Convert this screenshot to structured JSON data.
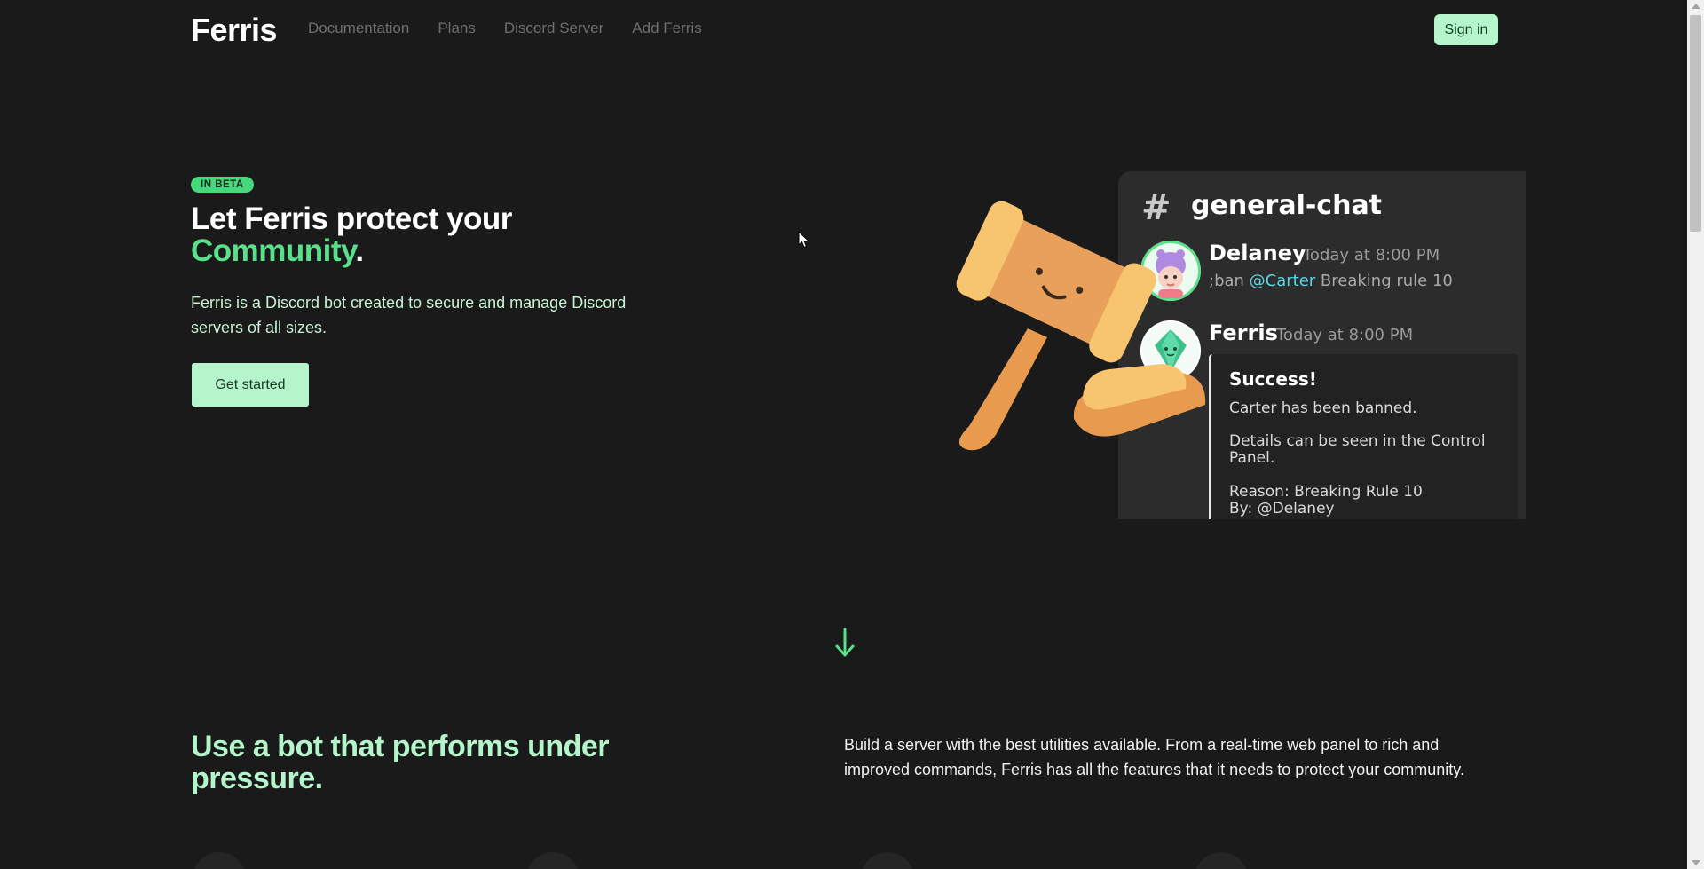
{
  "nav": {
    "logo": "Ferris",
    "links": [
      "Documentation",
      "Plans",
      "Discord Server",
      "Add Ferris"
    ],
    "signin_label": "Sign in"
  },
  "hero": {
    "badge": "IN BETA",
    "title_line1": "Let Ferris protect your",
    "title_accent": "Community",
    "title_end": ".",
    "description": "Ferris is a Discord bot created to secure and manage Discord servers of all sizes.",
    "cta_label": "Get started"
  },
  "chat": {
    "hash": "#",
    "channel": "general-chat",
    "message1": {
      "author": "Delaney",
      "time": "Today at 8:00 PM",
      "prefix": ";ban ",
      "mention": "@Carter",
      "suffix": " Breaking rule 10"
    },
    "message2": {
      "author": "Ferris",
      "time": "Today at 8:00 PM"
    },
    "embed": {
      "title": "Success!",
      "line1": "Carter has been banned.",
      "line2": "Details can be seen in the Control Panel.",
      "line3": "Reason: Breaking Rule 10",
      "line4": "By: @Delaney"
    }
  },
  "section2": {
    "title": "Use a bot that performs under pressure.",
    "description": "Build a server with the best utilities available. From a real-time web panel to rich and improved commands, Ferris has all the features that it needs to protect your community."
  },
  "icons": {
    "scroll": "arrow-down-icon",
    "cursor": "mouse-cursor-icon",
    "gavel": "gavel-illustration"
  },
  "colors": {
    "background": "#1a1a1a",
    "accent": "#5ae08b",
    "mint": "#b4f5cb",
    "badge": "#47d77d",
    "mention": "#5ad6e6"
  }
}
